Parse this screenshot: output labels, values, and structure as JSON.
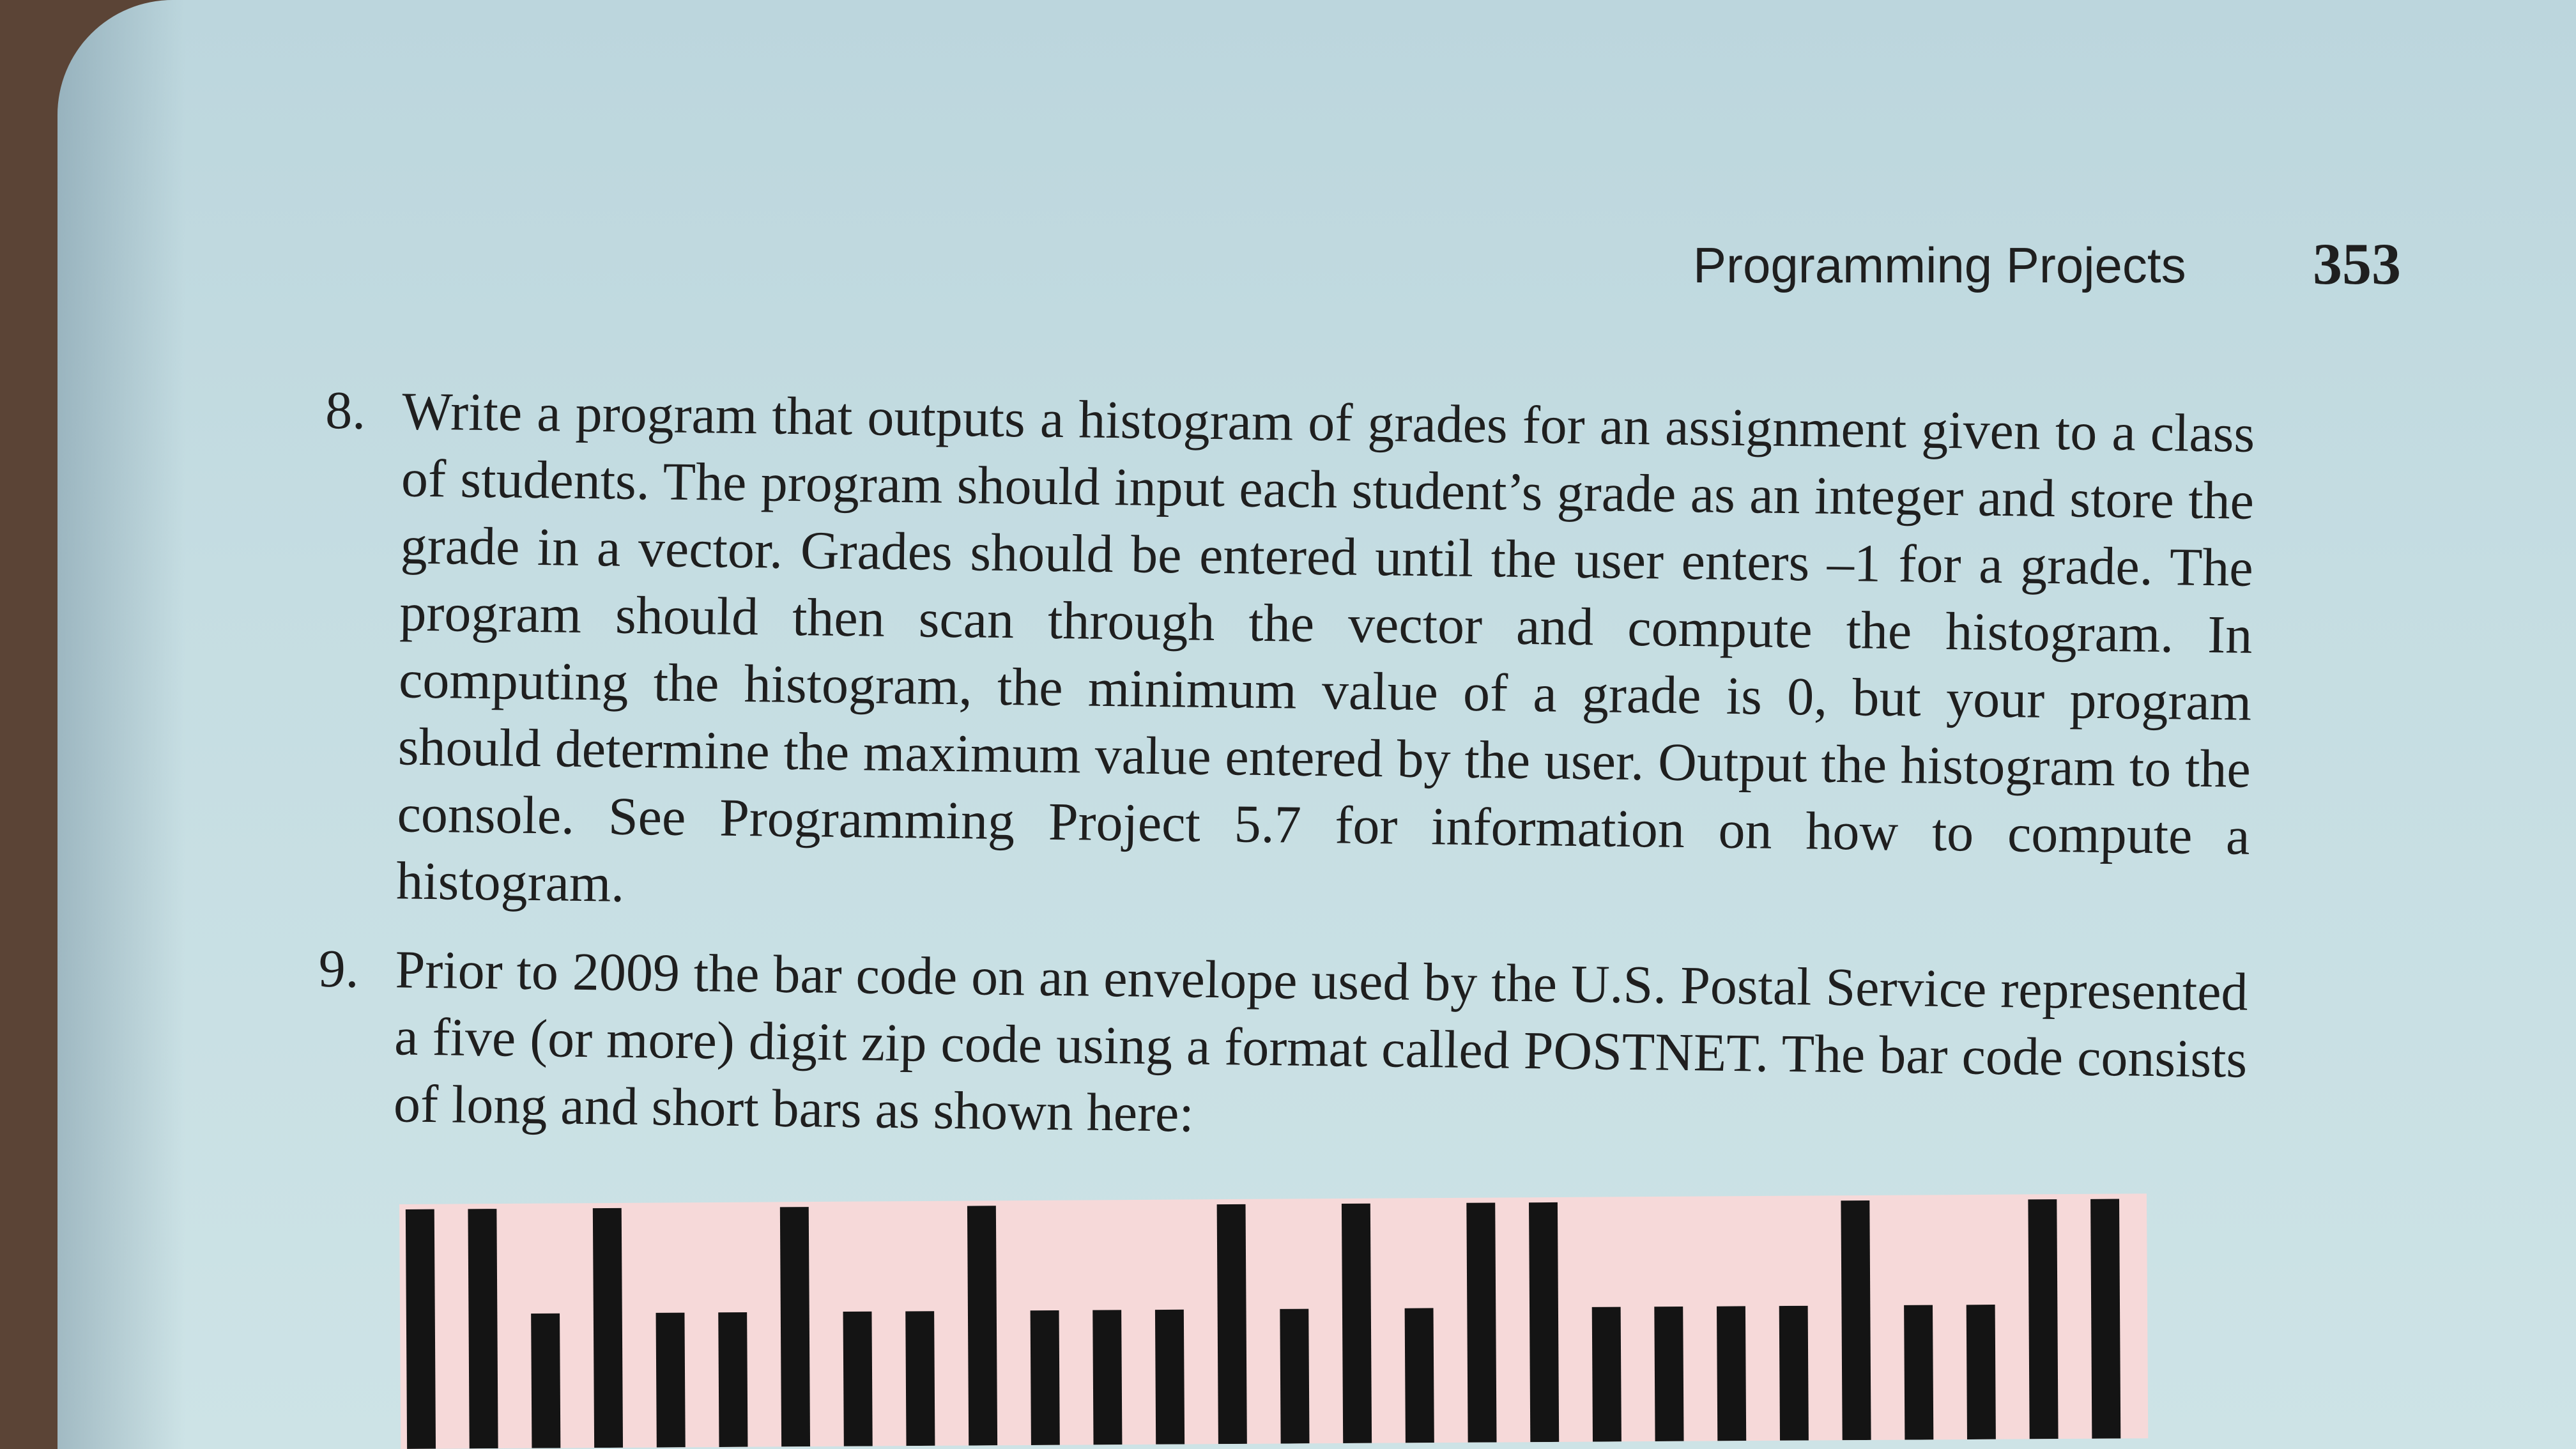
{
  "header": {
    "running_title": "Programming Projects",
    "page_number": "353"
  },
  "projects": [
    {
      "number": "8.",
      "text": "Write a program that outputs a histogram of grades for an assignment given to a class of students. The program should input each student’s grade as an integer and store the grade in a vector. Grades should be entered until the user enters –1 for a grade. The program should then scan through the vector and compute the histogram. In computing the histogram, the minimum value of a grade is 0, but your program should determine the maximum value entered by the user. Output the histogram to the console. See Programming Project 5.7 for information on how to compute a histogram."
    },
    {
      "number": "9.",
      "text": "Prior to 2009 the bar code on an envelope used by the U.S. Postal Service represented a five (or more) digit zip code using a format called POSTNET. The bar code consists of long and short bars as shown here:"
    }
  ],
  "barcode": {
    "bars": [
      "long",
      "long",
      "short",
      "long",
      "short",
      "short",
      "long",
      "short",
      "short",
      "long",
      "short",
      "short",
      "short",
      "long",
      "short",
      "long",
      "short",
      "long",
      "long",
      "short",
      "short",
      "short",
      "short",
      "long",
      "short",
      "short",
      "long",
      "long"
    ],
    "bar_color": "#141414",
    "background_color": "#f6d9d9"
  }
}
